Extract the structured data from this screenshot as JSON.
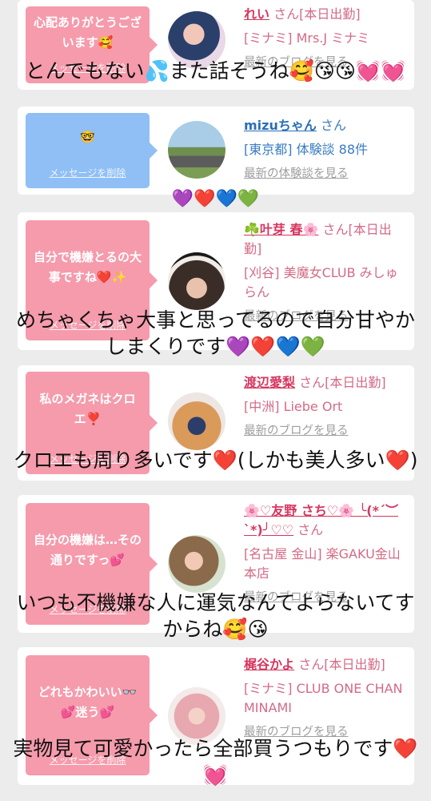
{
  "cards": [
    {
      "message": "心配ありがとうございます🥰",
      "delete_label": "メッセージを削除",
      "name": "れい",
      "san": "さん[本日出勤]",
      "shop": "[ミナミ] Mrs.J ミナミ",
      "latest": "最新のブログを見る"
    },
    {
      "message": "🤓",
      "delete_label": "メッセージを削除",
      "name": "mizuちゃん",
      "san": "さん",
      "shop": "[東京都] 体験談 88件",
      "latest": "最新の体験談を見る"
    },
    {
      "message": "自分で機嫌とるの大事ですね❤️✨",
      "delete_label": "メッセージを削除",
      "name": "☘️叶芽 春🌸",
      "san": "さん[本日出勤]",
      "shop": "[刈谷] 美魔女CLUB みしゅらん",
      "latest": "最新のブログを見る"
    },
    {
      "message": "私のメガネはクロエ❣️",
      "delete_label": "メッセージを削除",
      "name": "渡辺愛梨",
      "san": "さん[本日出勤]",
      "shop": "[中洲] Liebe Ort",
      "latest": "最新のブログを見る"
    },
    {
      "message": "自分の機嫌は…その通りですっ💕",
      "delete_label": "メッセージを削除",
      "name": "🌸♡友野 さち♡🌸 ╰(*´︶`*)╯♡♡",
      "san": "さん",
      "shop": "[名古屋 金山] 楽GAKU金山本店",
      "latest": "最新のブログを見る"
    },
    {
      "message": "どれもかわいい👓💕迷う💕",
      "delete_label": "メッセージを削除",
      "name": "梶谷かよ",
      "san": "さん[本日出勤]",
      "shop": "[ミナミ] CLUB ONE CHAN MINAMI",
      "latest": "最新のブログを見る"
    }
  ],
  "overlays": [
    "とんでもない💦また話そうね🥰😘😘💓💓",
    "💜❤️💙💚",
    "めちゃくちゃ大事と思ってるので自分甘やかしまくりです💜❤️💙💚",
    "クロエも周り多いです❤️(しかも美人多い❤️)",
    "いつも不機嫌な人に運気なんてよらないてすからね🥰😘",
    "実物見て可愛かったら全部買うつもりです❤️💓"
  ]
}
